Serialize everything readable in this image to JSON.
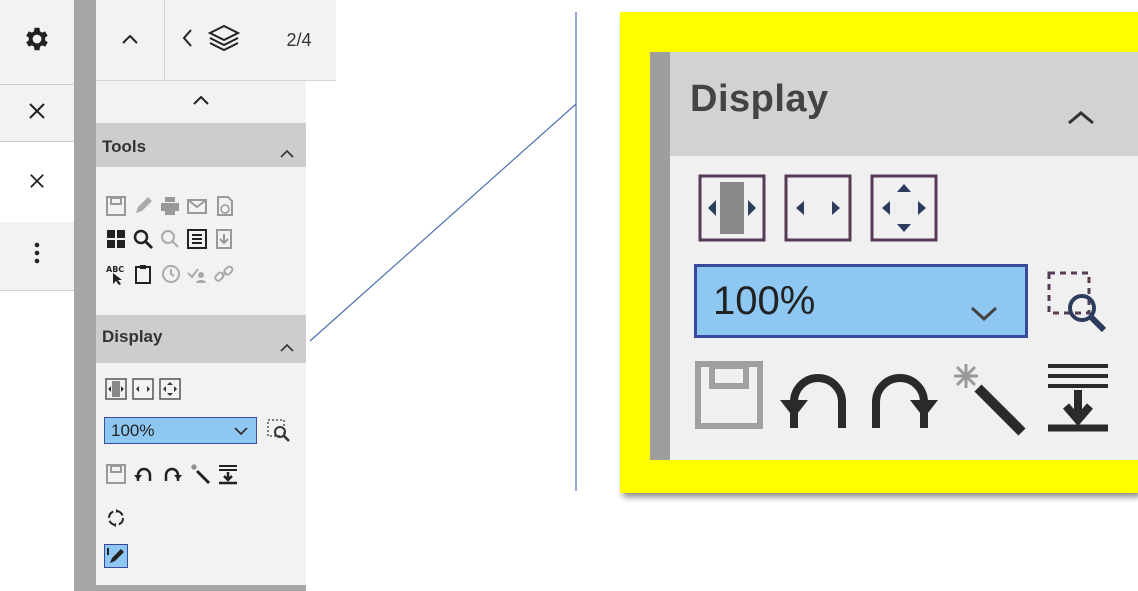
{
  "colors": {
    "accent_blue": "#8ec7f2",
    "rail_gray": "#a6a6a6",
    "highlight_yellow": "#ffff00",
    "callout_line": "#4e6fb0"
  },
  "left_strip": {
    "items": [
      {
        "name": "gear-icon",
        "glyph": "⚙"
      },
      {
        "name": "close-icon",
        "glyph": "✕"
      },
      {
        "name": "close-icon",
        "glyph": "✕"
      },
      {
        "name": "more-vertical-icon",
        "glyph": "⋮"
      }
    ]
  },
  "topbar": {
    "page_indicator": "2/4"
  },
  "sections": {
    "tools": {
      "title": "Tools"
    },
    "display": {
      "title": "Display"
    }
  },
  "zoom": {
    "value": "100%"
  },
  "magnified": {
    "title": "Display",
    "zoom_value": "100%"
  }
}
